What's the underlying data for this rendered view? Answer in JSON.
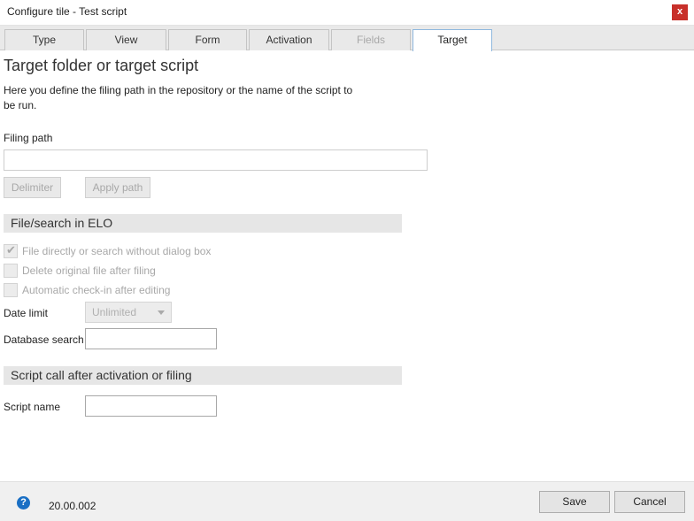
{
  "window": {
    "title": "Configure tile - Test script",
    "close_label": "x"
  },
  "tabs": [
    {
      "label": "Type",
      "state": "normal"
    },
    {
      "label": "View",
      "state": "normal"
    },
    {
      "label": "Form",
      "state": "normal"
    },
    {
      "label": "Activation",
      "state": "normal"
    },
    {
      "label": "Fields",
      "state": "disabled"
    },
    {
      "label": "Target",
      "state": "active"
    }
  ],
  "main": {
    "heading": "Target folder or target script",
    "description": "Here you define the filing path in the repository or the name of the script to be run.",
    "filing_path": {
      "label": "Filing path",
      "value": "",
      "delimiter_label": "Delimiter",
      "apply_path_label": "Apply path"
    },
    "file_search_section": {
      "title": "File/search in ELO",
      "checkboxes": [
        {
          "label": "File directly or search without dialog box",
          "checked": true,
          "disabled": true
        },
        {
          "label": "Delete original file after filing",
          "checked": false,
          "disabled": true
        },
        {
          "label": "Automatic check-in after editing",
          "checked": false,
          "disabled": true
        }
      ],
      "date_limit": {
        "label": "Date limit",
        "value": "Unlimited"
      },
      "database_search": {
        "label": "Database search",
        "value": ""
      }
    },
    "script_section": {
      "title": "Script call after activation or filing",
      "script_name": {
        "label": "Script name",
        "value": ""
      }
    }
  },
  "footer": {
    "help_icon": "question-circle-icon",
    "version": "20.00.002",
    "save_label": "Save",
    "cancel_label": "Cancel"
  },
  "colors": {
    "close_button": "#c8302a",
    "help_icon": "#1a6fc4",
    "active_tab_border": "#8fb8de"
  }
}
